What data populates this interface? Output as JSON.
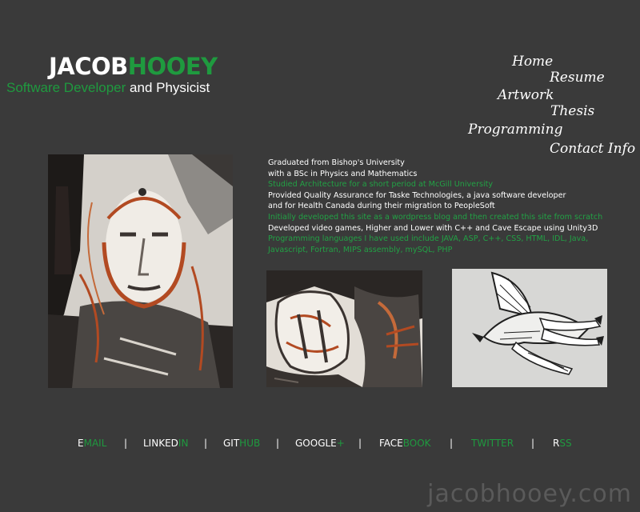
{
  "header": {
    "name_part1": "JACOB",
    "name_part2": "HOOEY",
    "subtitle_part1": "Software Developer",
    "subtitle_part2": " and Physicist"
  },
  "nav": {
    "home": "Home",
    "resume": "Resume",
    "artwork": "Artwork",
    "thesis": "Thesis",
    "programming": "Programming",
    "contact": "Contact Info"
  },
  "bio": [
    "Graduated from Bishop's University",
    "with a BSc in Physics and Mathematics",
    "Studied Architecture for a short period at McGill University",
    "Provided Quality Assurance for Taske Technologies, a java software developer",
    "and for Health Canada during their migration to PeopleSoft",
    "Initially developed this site as a wordpress blog and then created this site from scratch",
    "Developed video games, Higher and Lower with C++ and Cave Escape using Unity3D",
    "Programming languages I have used include JAVA, ASP, C++, CSS, HTML, IDL, Java,",
    "Javascript, Fortran, MIPS assembly, mySQL, PHP"
  ],
  "social": {
    "email": [
      "E",
      "MAIL"
    ],
    "linkedin": [
      "LINKED",
      "IN"
    ],
    "github": [
      "GIT",
      "HUB"
    ],
    "google": [
      "GOOGLE",
      "+"
    ],
    "facebook": [
      "FACE",
      "BOOK"
    ],
    "twitter": [
      "",
      "TWITTER"
    ],
    "rss": [
      "R",
      "SS"
    ],
    "separator": "|"
  },
  "watermark": "jacobhooey.com",
  "colors": {
    "background": "#3a3a3a",
    "accent_green": "#1f9a3f",
    "text": "#ffffff",
    "watermark": "#5a5a5a"
  },
  "artworks": [
    {
      "icon": "face-portrait-painting-image"
    },
    {
      "icon": "figure-sketch-painting-image"
    },
    {
      "icon": "bird-drawing-image"
    }
  ]
}
